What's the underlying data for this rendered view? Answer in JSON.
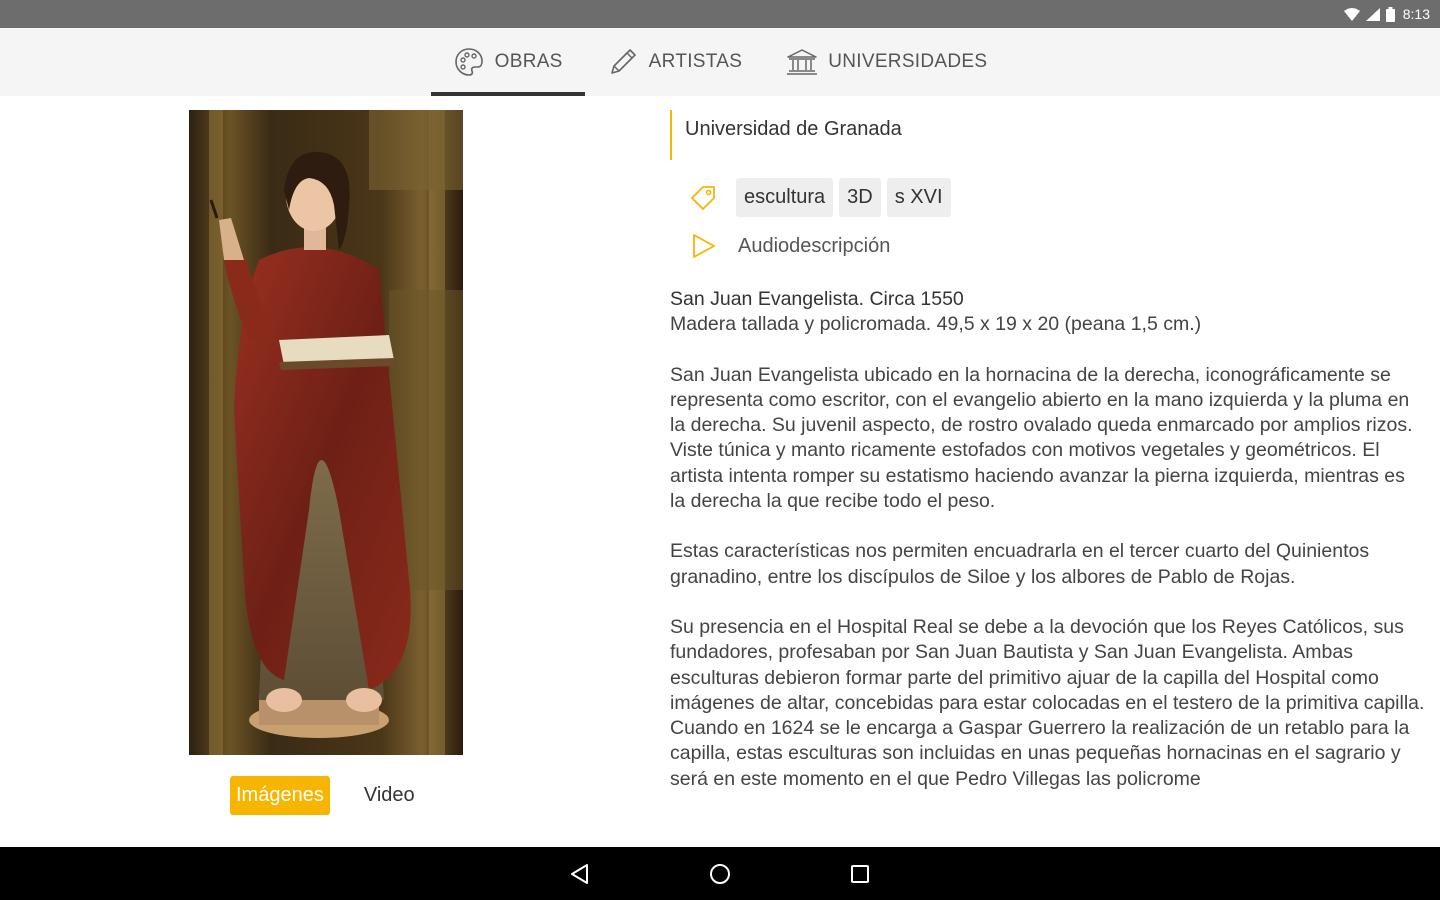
{
  "status_bar": {
    "time": "8:13",
    "icons": [
      "wifi-icon",
      "signal-icon",
      "battery-icon"
    ]
  },
  "nav": {
    "tabs": [
      {
        "label": "OBRAS",
        "icon": "palette-icon",
        "active": true
      },
      {
        "label": "ARTISTAS",
        "icon": "pencil-icon",
        "active": false
      },
      {
        "label": "UNIVERSIDADES",
        "icon": "university-building-icon",
        "active": false
      }
    ]
  },
  "media": {
    "tabs": [
      {
        "label": "Imágenes",
        "active": true
      },
      {
        "label": "Video",
        "active": false
      }
    ]
  },
  "artwork": {
    "university": "Universidad de Granada",
    "tags": [
      "escultura",
      "3D",
      "s XVI"
    ],
    "audio_label": "Audiodescripción",
    "title": "San Juan Evangelista. Circa 1550",
    "material": "Madera tallada y policromada. 49,5 x 19 x 20  (peana 1,5 cm.)",
    "paragraphs": [
      "San Juan Evangelista ubicado en la hornacina de la derecha, iconográficamente se representa como escritor, con el evangelio abierto en la mano izquierda y la pluma en la derecha. Su juvenil aspecto, de rostro ovalado queda enmarcado por amplios rizos. Viste túnica y manto ricamente estofados con motivos vegetales y geométricos. El artista intenta romper su estatismo haciendo avanzar la pierna izquierda, mientras es la derecha la que recibe todo el peso.",
      "Estas características nos permiten encuadrarla en el tercer cuarto del Quinientos granadino, entre los discípulos de Siloe y los albores de Pablo de Rojas.",
      "Su presencia en el Hospital Real se debe a la devoción que los Reyes Católicos, sus fundadores,  profesaban por San Juan Bautista y San Juan Evangelista. Ambas esculturas debieron formar parte del primitivo ajuar de la capilla del Hospital como imágenes de altar, concebidas para estar colocadas en el testero de la primitiva capilla. Cuando en 1624 se le encarga a Gaspar Guerrero la realización de un retablo para la capilla, estas esculturas son incluidas en unas pequeñas hornacinas en el  sagrario y será en este momento en el que Pedro Villegas las policrome"
    ]
  },
  "system_nav": {
    "buttons": [
      "back-icon",
      "home-icon",
      "recents-icon"
    ]
  },
  "colors": {
    "accent": "#f7b500",
    "status_bar": "#6d6d6d",
    "nav_bg": "#f5f5f5",
    "tag_bg": "#eeeeee"
  }
}
